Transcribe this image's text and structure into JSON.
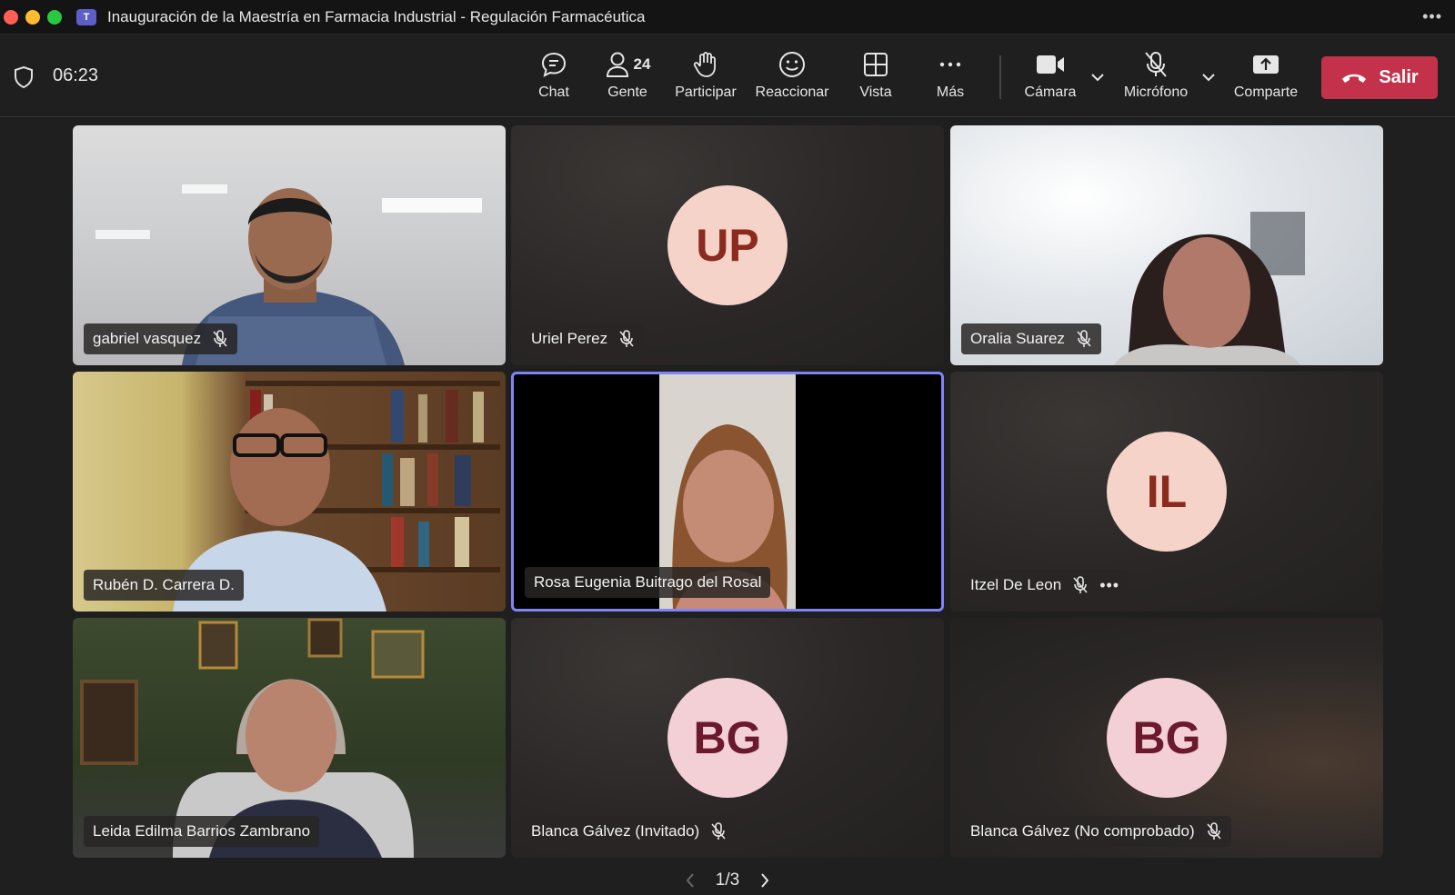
{
  "window": {
    "title": "Inauguración de la Maestría en Farmacia Industrial - Regulación Farmacéutica",
    "more_icon": "more-horizontal-icon",
    "app_icon": "teams-logo"
  },
  "toolbar": {
    "timer": "06:23",
    "chat_label": "Chat",
    "people_label": "Gente",
    "people_count": "24",
    "raise_label": "Participar",
    "react_label": "Reaccionar",
    "view_label": "Vista",
    "more_label": "Más",
    "camera_label": "Cámara",
    "mic_label": "Micrófono",
    "share_label": "Comparte",
    "leave_label": "Salir",
    "leave_color": "#c4314b"
  },
  "participants": [
    {
      "name": "gabriel vasquez",
      "muted": true,
      "video": true
    },
    {
      "name": "Uriel Perez",
      "muted": true,
      "video": false,
      "initials": "UP",
      "avatar_bg": "#f5d3c9",
      "avatar_fg": "#8a2b1e"
    },
    {
      "name": "Oralia Suarez",
      "muted": true,
      "video": true
    },
    {
      "name": "Rubén D. Carrera D.",
      "muted": false,
      "video": true
    },
    {
      "name": "Rosa Eugenia Buitrago del Rosal",
      "muted": false,
      "video": true,
      "speaking": true
    },
    {
      "name": "Itzel De Leon",
      "muted": true,
      "video": false,
      "initials": "IL",
      "avatar_bg": "#f5d3c9",
      "avatar_fg": "#8a2b1e"
    },
    {
      "name": "Leida Edilma Barrios Zambrano",
      "muted": false,
      "video": true
    },
    {
      "name": "Blanca Gálvez (Invitado)",
      "muted": true,
      "video": false,
      "initials": "BG",
      "avatar_bg": "#f3cfd6",
      "avatar_fg": "#6b1a2e"
    },
    {
      "name": "Blanca Gálvez (No comprobado)",
      "muted": true,
      "video": false,
      "initials": "BG",
      "avatar_bg": "#f3cfd6",
      "avatar_fg": "#6b1a2e"
    }
  ],
  "pager": {
    "label": "1/3"
  },
  "colors": {
    "active_border": "#7f85f5",
    "background": "#1f1f1f"
  }
}
